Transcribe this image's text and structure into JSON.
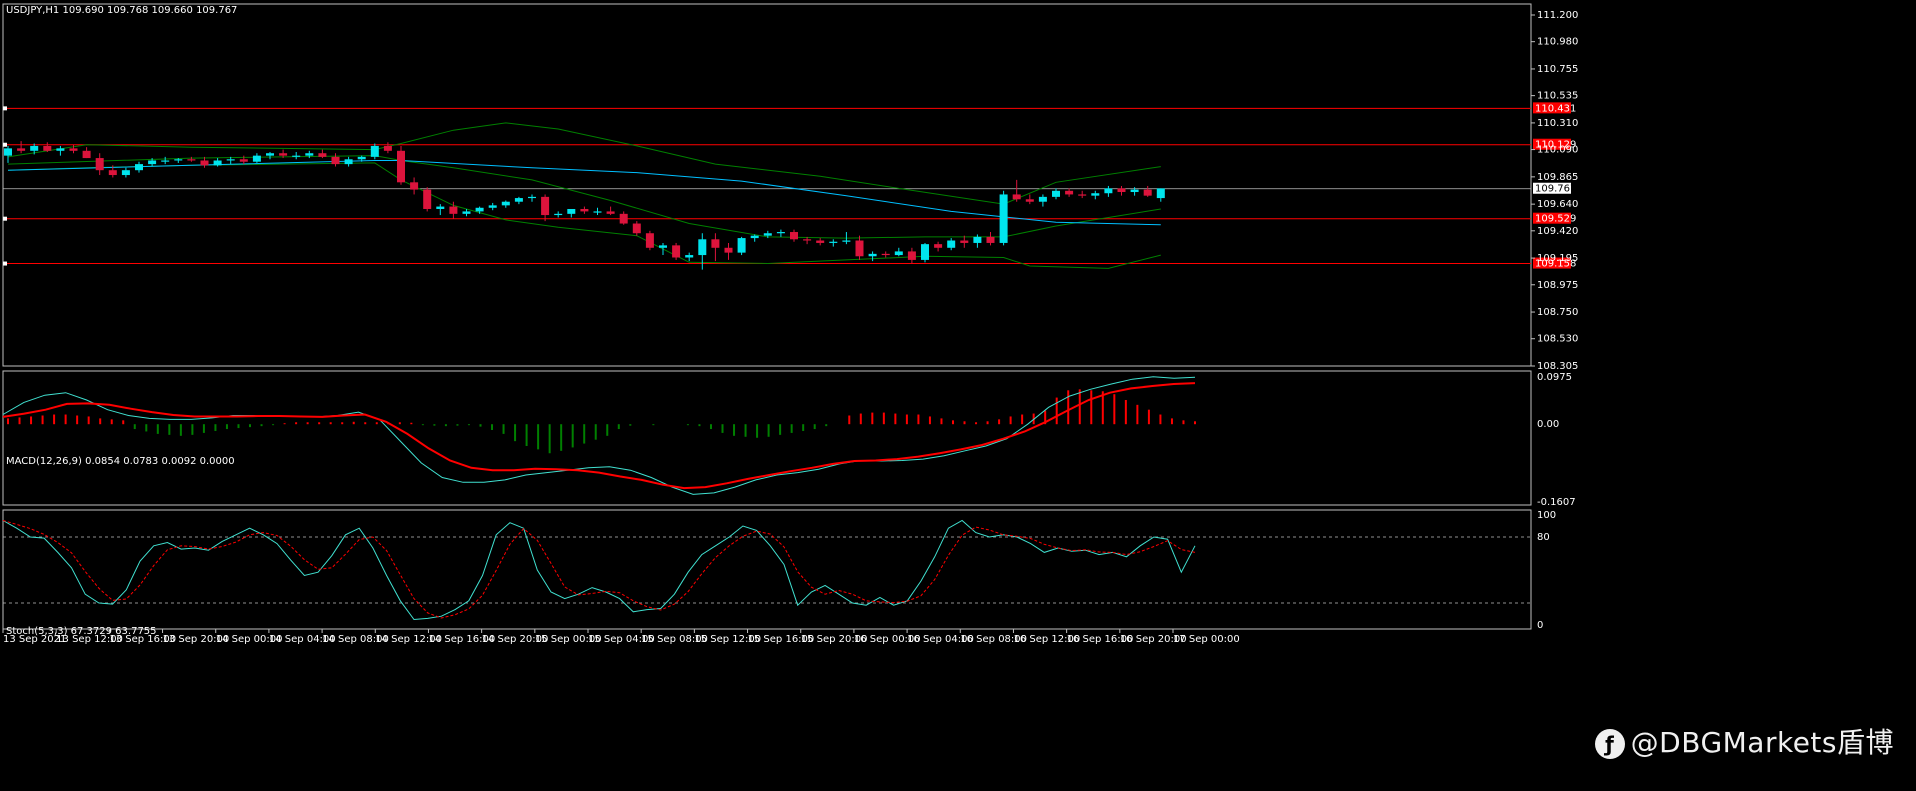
{
  "header": {
    "symbol_label": "USDJPY,H1  109.690 109.768 109.660 109.767"
  },
  "macd_header": {
    "label": "MACD(12,26,9) 0.0854 0.0783 0.0092 0.0000"
  },
  "stoch_header": {
    "label": "Stoch(5,3,3) 67.3729 63.7755"
  },
  "watermark": {
    "text": "@DBGMarkets盾博",
    "icon": "weibo-icon"
  },
  "colors": {
    "background": "#000000",
    "bull_candle": "#00e5ee",
    "bear_candle": "#dc143c",
    "grid_border": "#c0c0c0",
    "level_line": "#ff0000",
    "bollinger": "#008000",
    "ma_line": "#00bfff",
    "macd_main": "#40e0d0",
    "macd_signal": "#ff0000",
    "stoch_main": "#40e0d0",
    "stoch_signal": "#ff0000"
  },
  "chart_data": [
    {
      "type": "candlestick",
      "title": "USDJPY,H1",
      "symbol": "USDJPY",
      "timeframe": "H1",
      "ohlc_last": {
        "open": 109.69,
        "high": 109.768,
        "low": 109.66,
        "close": 109.767
      },
      "ylim": [
        108.305,
        111.2
      ],
      "y_ticks": [
        "111.200",
        "110.980",
        "110.755",
        "110.535",
        "110.310",
        "110.090",
        "109.865",
        "109.640",
        "109.420",
        "109.195",
        "108.975",
        "108.750",
        "108.530",
        "108.305"
      ],
      "x_ticks": [
        "13 Sep 2021",
        "13 Sep 12:00",
        "13 Sep 16:00",
        "13 Sep 20:00",
        "14 Sep 00:00",
        "14 Sep 04:00",
        "14 Sep 08:00",
        "14 Sep 12:00",
        "14 Sep 16:00",
        "14 Sep 20:00",
        "15 Sep 00:00",
        "15 Sep 04:00",
        "15 Sep 08:00",
        "15 Sep 12:00",
        "15 Sep 16:00",
        "15 Sep 20:00",
        "16 Sep 00:00",
        "16 Sep 04:00",
        "16 Sep 08:00",
        "16 Sep 12:00",
        "16 Sep 16:00",
        "16 Sep 20:00",
        "17 Sep 00:00"
      ],
      "current_price": {
        "value": 109.767,
        "label": "109.767"
      },
      "levels": [
        {
          "value": 110.43,
          "label": "110.431"
        },
        {
          "value": 110.13,
          "label": "110.129"
        },
        {
          "value": 109.52,
          "label": "109.529"
        },
        {
          "value": 109.15,
          "label": "109.158"
        }
      ],
      "candles": [
        [
          110.04,
          110.12,
          109.98,
          110.1
        ],
        [
          110.1,
          110.16,
          110.06,
          110.08
        ],
        [
          110.08,
          110.14,
          110.05,
          110.12
        ],
        [
          110.12,
          110.15,
          110.07,
          110.08
        ],
        [
          110.08,
          110.12,
          110.04,
          110.1
        ],
        [
          110.1,
          110.13,
          110.06,
          110.08
        ],
        [
          110.08,
          110.11,
          110.02,
          110.02
        ],
        [
          110.02,
          110.06,
          109.88,
          109.92
        ],
        [
          109.92,
          109.96,
          109.86,
          109.88
        ],
        [
          109.88,
          109.94,
          109.86,
          109.92
        ],
        [
          109.92,
          109.99,
          109.9,
          109.97
        ],
        [
          109.97,
          110.02,
          109.95,
          110.0
        ],
        [
          110.0,
          110.03,
          109.97,
          110.0
        ],
        [
          110.0,
          110.02,
          109.98,
          110.01
        ],
        [
          110.01,
          110.03,
          109.99,
          110.0
        ],
        [
          110.0,
          110.03,
          109.94,
          109.96
        ],
        [
          109.96,
          110.02,
          109.95,
          110.0
        ],
        [
          110.0,
          110.03,
          109.97,
          110.01
        ],
        [
          110.01,
          110.04,
          109.97,
          109.99
        ],
        [
          109.99,
          110.06,
          109.98,
          110.04
        ],
        [
          110.04,
          110.07,
          110.01,
          110.06
        ],
        [
          110.06,
          110.09,
          110.02,
          110.04
        ],
        [
          110.04,
          110.07,
          110.01,
          110.04
        ],
        [
          110.04,
          110.08,
          110.02,
          110.06
        ],
        [
          110.06,
          110.09,
          110.02,
          110.03
        ],
        [
          110.03,
          110.06,
          109.95,
          109.97
        ],
        [
          109.97,
          110.03,
          109.95,
          110.01
        ],
        [
          110.01,
          110.04,
          109.99,
          110.03
        ],
        [
          110.03,
          110.14,
          110.01,
          110.12
        ],
        [
          110.12,
          110.15,
          110.06,
          110.08
        ],
        [
          110.08,
          110.12,
          109.8,
          109.82
        ],
        [
          109.82,
          109.86,
          109.72,
          109.76
        ],
        [
          109.76,
          109.78,
          109.58,
          109.6
        ],
        [
          109.6,
          109.64,
          109.55,
          109.62
        ],
        [
          109.62,
          109.66,
          109.52,
          109.56
        ],
        [
          109.56,
          109.6,
          109.54,
          109.58
        ],
        [
          109.58,
          109.62,
          109.56,
          109.61
        ],
        [
          109.61,
          109.65,
          109.59,
          109.63
        ],
        [
          109.63,
          109.67,
          109.61,
          109.66
        ],
        [
          109.66,
          109.7,
          109.64,
          109.69
        ],
        [
          109.69,
          109.72,
          109.66,
          109.7
        ],
        [
          109.7,
          109.72,
          109.5,
          109.55
        ],
        [
          109.55,
          109.58,
          109.53,
          109.56
        ],
        [
          109.56,
          109.6,
          109.53,
          109.6
        ],
        [
          109.6,
          109.62,
          109.56,
          109.58
        ],
        [
          109.58,
          109.61,
          109.55,
          109.58
        ],
        [
          109.58,
          109.62,
          109.55,
          109.56
        ],
        [
          109.56,
          109.58,
          109.47,
          109.48
        ],
        [
          109.48,
          109.5,
          109.38,
          109.4
        ],
        [
          109.4,
          109.42,
          109.26,
          109.28
        ],
        [
          109.28,
          109.32,
          109.22,
          109.3
        ],
        [
          109.3,
          109.32,
          109.18,
          109.2
        ],
        [
          109.2,
          109.24,
          109.17,
          109.22
        ],
        [
          109.22,
          109.4,
          109.1,
          109.35
        ],
        [
          109.35,
          109.4,
          109.17,
          109.28
        ],
        [
          109.28,
          109.32,
          109.18,
          109.24
        ],
        [
          109.24,
          109.37,
          109.22,
          109.36
        ],
        [
          109.36,
          109.39,
          109.33,
          109.38
        ],
        [
          109.38,
          109.42,
          109.36,
          109.4
        ],
        [
          109.4,
          109.43,
          109.37,
          109.41
        ],
        [
          109.41,
          109.43,
          109.33,
          109.35
        ],
        [
          109.35,
          109.37,
          109.31,
          109.34
        ],
        [
          109.34,
          109.36,
          109.3,
          109.32
        ],
        [
          109.32,
          109.35,
          109.29,
          109.33
        ],
        [
          109.33,
          109.41,
          109.31,
          109.34
        ],
        [
          109.34,
          109.38,
          109.18,
          109.21
        ],
        [
          109.21,
          109.25,
          109.17,
          109.23
        ],
        [
          109.23,
          109.25,
          109.2,
          109.22
        ],
        [
          109.22,
          109.28,
          109.21,
          109.25
        ],
        [
          109.25,
          109.28,
          109.15,
          109.18
        ],
        [
          109.18,
          109.32,
          109.16,
          109.31
        ],
        [
          109.31,
          109.33,
          109.25,
          109.28
        ],
        [
          109.28,
          109.36,
          109.26,
          109.34
        ],
        [
          109.34,
          109.38,
          109.28,
          109.32
        ],
        [
          109.32,
          109.39,
          109.28,
          109.37
        ],
        [
          109.37,
          109.41,
          109.3,
          109.32
        ],
        [
          109.32,
          109.75,
          109.3,
          109.72
        ],
        [
          109.72,
          109.84,
          109.66,
          109.68
        ],
        [
          109.68,
          109.72,
          109.64,
          109.66
        ],
        [
          109.66,
          109.72,
          109.62,
          109.7
        ],
        [
          109.7,
          109.77,
          109.68,
          109.75
        ],
        [
          109.75,
          109.77,
          109.7,
          109.72
        ],
        [
          109.72,
          109.75,
          109.69,
          109.71
        ],
        [
          109.71,
          109.75,
          109.68,
          109.73
        ],
        [
          109.73,
          109.79,
          109.7,
          109.77
        ],
        [
          109.77,
          109.79,
          109.71,
          109.74
        ],
        [
          109.74,
          109.78,
          109.71,
          109.76
        ],
        [
          109.76,
          109.79,
          109.7,
          109.71
        ],
        [
          109.69,
          109.77,
          109.66,
          109.77
        ]
      ],
      "bollinger_upper": [
        [
          0,
          110.03
        ],
        [
          6,
          110.13
        ],
        [
          14,
          110.11
        ],
        [
          28,
          110.09
        ],
        [
          30,
          110.14
        ],
        [
          34,
          110.25
        ],
        [
          38,
          110.31
        ],
        [
          42,
          110.26
        ],
        [
          48,
          110.12
        ],
        [
          54,
          109.97
        ],
        [
          62,
          109.87
        ],
        [
          68,
          109.77
        ],
        [
          76,
          109.64
        ],
        [
          80,
          109.82
        ],
        [
          88,
          109.95
        ]
      ],
      "bollinger_lower": [
        [
          0,
          109.92
        ],
        [
          6,
          109.94
        ],
        [
          14,
          109.96
        ],
        [
          28,
          109.98
        ],
        [
          30,
          109.84
        ],
        [
          34,
          109.63
        ],
        [
          38,
          109.51
        ],
        [
          42,
          109.45
        ],
        [
          48,
          109.38
        ],
        [
          52,
          109.16
        ],
        [
          58,
          109.15
        ],
        [
          64,
          109.18
        ],
        [
          70,
          109.21
        ],
        [
          76,
          109.2
        ],
        [
          78,
          109.13
        ],
        [
          84,
          109.11
        ],
        [
          88,
          109.22
        ]
      ],
      "bollinger_middle": [
        [
          0,
          109.97
        ],
        [
          14,
          110.02
        ],
        [
          28,
          110.04
        ],
        [
          30,
          110.0
        ],
        [
          34,
          109.94
        ],
        [
          40,
          109.84
        ],
        [
          46,
          109.67
        ],
        [
          52,
          109.48
        ],
        [
          58,
          109.37
        ],
        [
          64,
          109.36
        ],
        [
          70,
          109.37
        ],
        [
          76,
          109.37
        ],
        [
          80,
          109.46
        ],
        [
          88,
          109.6
        ]
      ],
      "moving_average": [
        [
          0,
          109.92
        ],
        [
          14,
          109.96
        ],
        [
          28,
          110.0
        ],
        [
          30,
          110.0
        ],
        [
          40,
          109.94
        ],
        [
          48,
          109.9
        ],
        [
          56,
          109.83
        ],
        [
          64,
          109.71
        ],
        [
          72,
          109.58
        ],
        [
          80,
          109.49
        ],
        [
          88,
          109.47
        ]
      ]
    },
    {
      "type": "histogram+line",
      "title": "MACD(12,26,9)",
      "ylim": [
        -0.1607,
        0.0975
      ],
      "y_ticks": [
        "0.0975",
        "0.00",
        "-0.1607"
      ],
      "main_line": [
        0.02,
        0.045,
        0.06,
        0.065,
        0.05,
        0.03,
        0.018,
        0.012,
        0.01,
        0.01,
        0.013,
        0.018,
        0.018,
        0.016,
        0.016,
        0.015,
        0.018,
        0.025,
        0.01,
        -0.035,
        -0.08,
        -0.11,
        -0.12,
        -0.12,
        -0.115,
        -0.105,
        -0.1,
        -0.095,
        -0.09,
        -0.088,
        -0.095,
        -0.11,
        -0.13,
        -0.145,
        -0.142,
        -0.13,
        -0.115,
        -0.105,
        -0.1,
        -0.093,
        -0.082,
        -0.075,
        -0.076,
        -0.075,
        -0.072,
        -0.065,
        -0.055,
        -0.045,
        -0.03,
        0.0,
        0.035,
        0.058,
        0.072,
        0.083,
        0.093,
        0.098,
        0.095,
        0.097
      ],
      "signal_line": [
        0.015,
        0.022,
        0.03,
        0.042,
        0.043,
        0.04,
        0.032,
        0.025,
        0.019,
        0.016,
        0.016,
        0.016,
        0.017,
        0.017,
        0.016,
        0.015,
        0.018,
        0.02,
        0.005,
        -0.02,
        -0.05,
        -0.075,
        -0.09,
        -0.095,
        -0.095,
        -0.092,
        -0.093,
        -0.095,
        -0.1,
        -0.108,
        -0.115,
        -0.125,
        -0.132,
        -0.13,
        -0.122,
        -0.113,
        -0.105,
        -0.097,
        -0.09,
        -0.082,
        -0.076,
        -0.075,
        -0.072,
        -0.067,
        -0.06,
        -0.052,
        -0.043,
        -0.03,
        -0.015,
        0.005,
        0.028,
        0.05,
        0.065,
        0.074,
        0.079,
        0.083,
        0.085
      ],
      "histogram": [
        0.012,
        0.014,
        0.016,
        0.018,
        0.02,
        0.02,
        0.018,
        0.016,
        0.012,
        0.01,
        0.008,
        -0.01,
        -0.015,
        -0.02,
        -0.022,
        -0.024,
        -0.022,
        -0.018,
        -0.014,
        -0.01,
        -0.008,
        -0.006,
        -0.004,
        -0.002,
        0.002,
        0.004,
        0.004,
        0.004,
        0.004,
        0.004,
        0.005,
        0.004,
        0.004,
        0.003,
        0.004,
        0.003,
        -0.002,
        -0.003,
        -0.004,
        -0.003,
        -0.002,
        -0.005,
        -0.012,
        -0.02,
        -0.035,
        -0.045,
        -0.052,
        -0.06,
        -0.055,
        -0.048,
        -0.04,
        -0.032,
        -0.024,
        -0.01,
        -0.003,
        0.0,
        -0.002,
        0.0,
        0.0,
        -0.002,
        -0.004,
        -0.01,
        -0.018,
        -0.024,
        -0.026,
        -0.028,
        -0.026,
        -0.022,
        -0.018,
        -0.014,
        -0.01,
        -0.004,
        0.0,
        0.018,
        0.022,
        0.024,
        0.024,
        0.022,
        0.02,
        0.02,
        0.016,
        0.012,
        0.008,
        0.006,
        0.004,
        0.006,
        0.01,
        0.016,
        0.02,
        0.022,
        0.028,
        0.055,
        0.07,
        0.072,
        0.07,
        0.068,
        0.062,
        0.05,
        0.04,
        0.03,
        0.02,
        0.012,
        0.008,
        0.006
      ]
    },
    {
      "type": "line",
      "title": "Stoch(5,3,3)",
      "ylim": [
        0,
        100
      ],
      "y_ticks": [
        "100",
        "80",
        "0"
      ],
      "levels": [
        80,
        20
      ],
      "k_line": [
        95,
        88,
        80,
        79,
        66,
        52,
        28,
        20,
        19,
        32,
        58,
        72,
        75,
        69,
        70,
        68,
        76,
        82,
        88,
        82,
        74,
        59,
        45,
        48,
        63,
        82,
        88,
        70,
        45,
        22,
        5,
        6,
        8,
        14,
        22,
        45,
        82,
        93,
        88,
        50,
        30,
        24,
        28,
        34,
        30,
        24,
        12,
        14,
        15,
        28,
        48,
        64,
        72,
        80,
        90,
        86,
        72,
        55,
        18,
        30,
        36,
        28,
        20,
        18,
        25,
        18,
        22,
        40,
        62,
        88,
        95,
        84,
        80,
        82,
        80,
        74,
        66,
        70,
        67,
        68,
        64,
        66,
        62,
        72,
        80,
        78,
        48,
        72
      ]
    }
  ]
}
